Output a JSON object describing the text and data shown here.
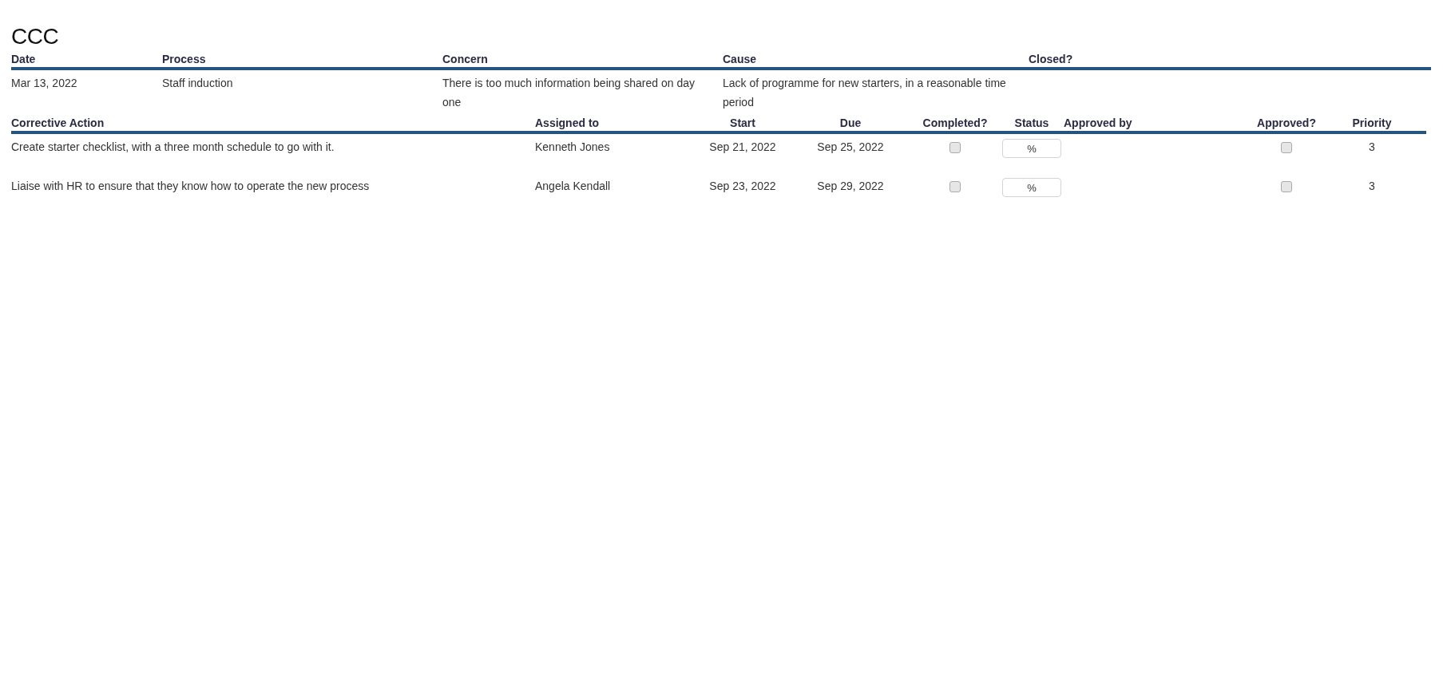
{
  "title": "CCC",
  "issue_table": {
    "columns": [
      "Date",
      "Process",
      "Concern",
      "Cause",
      "Closed?"
    ],
    "rows": [
      {
        "date": "Mar 13, 2022",
        "process": "Staff induction",
        "concern": "There is too much information being shared on day one",
        "cause": "Lack of programme for new starters, in a reasonable time period"
      }
    ]
  },
  "actions_table": {
    "columns": [
      "Corrective Action",
      "Assigned to",
      "Start",
      "Due",
      "Completed?",
      "Status",
      "Approved by",
      "Approved?",
      "Priority"
    ],
    "rows": [
      {
        "action": "Create starter checklist, with a three month schedule to go with it.",
        "assigned_to": "Kenneth Jones",
        "start": "Sep 21, 2022",
        "due": "Sep 25, 2022",
        "completed": false,
        "status": "%",
        "approved": false,
        "priority": "3"
      },
      {
        "action": "Liaise with HR to ensure that they know how to operate the new process",
        "assigned_to": "Angela Kendall",
        "start": "Sep 23, 2022",
        "due": "Sep 29, 2022",
        "completed": false,
        "status": "%",
        "approved": false,
        "priority": "3"
      }
    ]
  }
}
